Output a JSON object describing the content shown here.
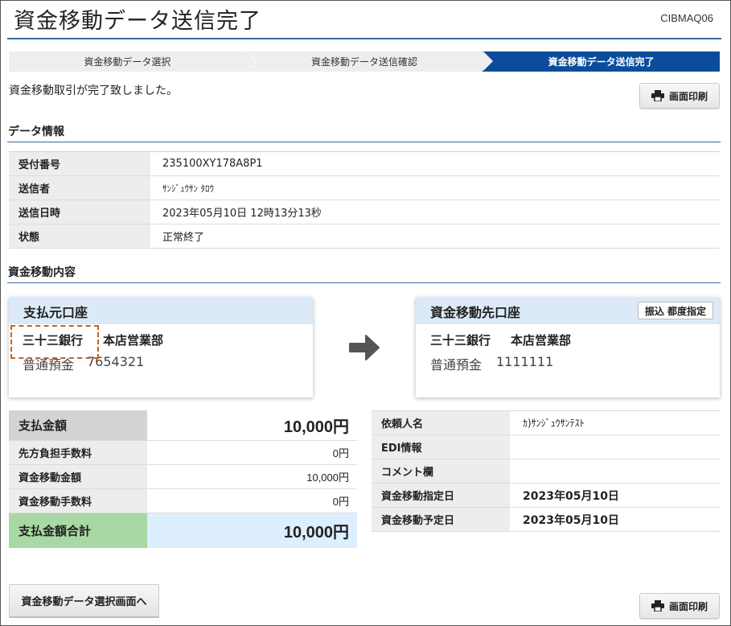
{
  "page": {
    "title": "資金移動データ送信完了",
    "screen_id": "CIBMAQ06"
  },
  "steps": [
    {
      "label": "資金移動データ選択"
    },
    {
      "label": "資金移動データ送信確認"
    },
    {
      "label": "資金移動データ送信完了"
    }
  ],
  "message": "資金移動取引が完了致しました。",
  "print_button": {
    "label": "画面印刷",
    "icon": "printer-icon"
  },
  "data_info": {
    "heading": "データ情報",
    "rows": [
      {
        "label": "受付番号",
        "value": "235100XY178A8P1"
      },
      {
        "label": "送信者",
        "value": "ｻﾝｼﾞｭｳｻﾝ ﾀﾛｳ"
      },
      {
        "label": "送信日時",
        "value": "2023年05月10日 12時13分13秒"
      },
      {
        "label": "状態",
        "value": "正常終了"
      }
    ]
  },
  "transfer": {
    "heading": "資金移動内容",
    "source": {
      "title": "支払元口座",
      "bank": "三十三銀行",
      "branch": "本店営業部",
      "account_type": "普通預金",
      "account_number": "7654321"
    },
    "destination": {
      "title": "資金移動先口座",
      "badge": "振込 都度指定",
      "bank": "三十三銀行",
      "branch": "本店営業部",
      "account_type": "普通預金",
      "account_number": "1111111"
    }
  },
  "amounts": {
    "payment_amount": {
      "label": "支払金額",
      "value": "10,000円"
    },
    "recipient_fee": {
      "label": "先方負担手数料",
      "value": "0円"
    },
    "transfer_amount": {
      "label": "資金移動金額",
      "value": "10,000円"
    },
    "transfer_fee": {
      "label": "資金移動手数料",
      "value": "0円"
    },
    "total": {
      "label": "支払金額合計",
      "value": "10,000円"
    }
  },
  "request": {
    "requester": {
      "label": "依頼人名",
      "value": "ｶ)ｻﾝｼﾞｭｳｻﾝﾃｽﾄ"
    },
    "edi": {
      "label": "EDI情報",
      "value": ""
    },
    "comment": {
      "label": "コメント欄",
      "value": ""
    },
    "designated_date": {
      "label": "資金移動指定日",
      "value": "2023年05月10日"
    },
    "scheduled_date": {
      "label": "資金移動予定日",
      "value": "2023年05月10日"
    }
  },
  "back_button": {
    "label": "資金移動データ選択画面へ"
  },
  "colors": {
    "accent": "#0b4d9a",
    "rule": "#3b6aa0",
    "card_header": "#dceaf7",
    "total_label": "#a8d8a4",
    "total_value": "#ddeeff",
    "highlight": "#c6641d"
  }
}
